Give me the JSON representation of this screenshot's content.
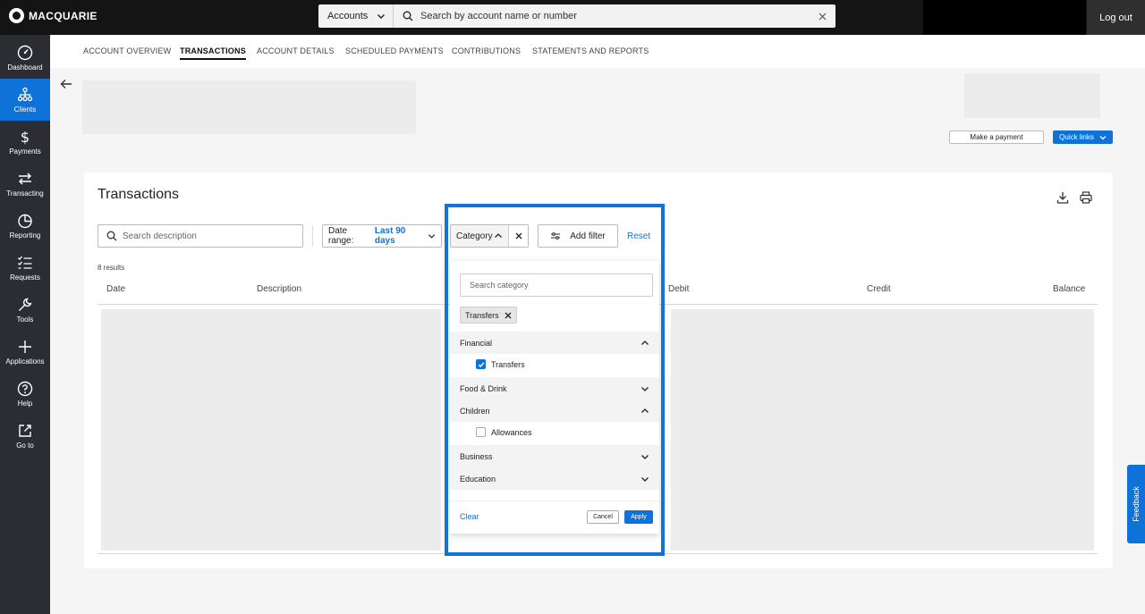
{
  "brand": {
    "name": "MACQUARIE"
  },
  "header": {
    "search_scope": "Accounts",
    "search_placeholder": "Search by account name or number",
    "logout_label": "Log out"
  },
  "sidebar": {
    "items": [
      {
        "label": "Dashboard",
        "icon": "dashboard-icon"
      },
      {
        "label": "Clients",
        "icon": "clients-icon"
      },
      {
        "label": "Payments",
        "icon": "dollar-icon"
      },
      {
        "label": "Transacting",
        "icon": "transfer-arrows-icon"
      },
      {
        "label": "Reporting",
        "icon": "pie-chart-icon"
      },
      {
        "label": "Requests",
        "icon": "checklist-icon"
      },
      {
        "label": "Tools",
        "icon": "wrench-icon"
      },
      {
        "label": "Applications",
        "icon": "plus-icon"
      },
      {
        "label": "Help",
        "icon": "help-icon"
      },
      {
        "label": "Go to",
        "icon": "external-link-icon"
      }
    ],
    "active_index": 1
  },
  "tabs": [
    {
      "label": "ACCOUNT OVERVIEW"
    },
    {
      "label": "TRANSACTIONS"
    },
    {
      "label": "ACCOUNT DETAILS"
    },
    {
      "label": "SCHEDULED PAYMENTS"
    },
    {
      "label": "CONTRIBUTIONS"
    },
    {
      "label": "STATEMENTS AND REPORTS"
    }
  ],
  "active_tab_index": 1,
  "actions": {
    "make_payment": "Make a payment",
    "quick_links": "Quick links"
  },
  "transactions": {
    "title": "Transactions",
    "search_placeholder": "Search description",
    "date_range_label": "Date range:",
    "date_range_value": "Last 90 days",
    "category_label": "Category",
    "add_filter_label": "Add filter",
    "reset_label": "Reset",
    "results_count": "8 results",
    "columns": [
      "Date",
      "Description",
      "Debit",
      "Credit",
      "Balance"
    ]
  },
  "category_dropdown": {
    "search_placeholder": "Search category",
    "selected_chips": [
      "Transfers"
    ],
    "groups": [
      {
        "name": "Financial",
        "expanded": true,
        "options": [
          {
            "label": "Transfers",
            "checked": true
          }
        ]
      },
      {
        "name": "Food & Drink",
        "expanded": false,
        "options": []
      },
      {
        "name": "Children",
        "expanded": true,
        "options": [
          {
            "label": "Allowances",
            "checked": false
          }
        ]
      },
      {
        "name": "Business",
        "expanded": false,
        "options": []
      },
      {
        "name": "Education",
        "expanded": false,
        "options": []
      }
    ],
    "clear_label": "Clear",
    "cancel_label": "Cancel",
    "apply_label": "Apply"
  },
  "feedback_label": "Feedback",
  "colors": {
    "accent": "#0f72d9",
    "topbar": "#141414",
    "sidebar": "#2b2d33"
  }
}
